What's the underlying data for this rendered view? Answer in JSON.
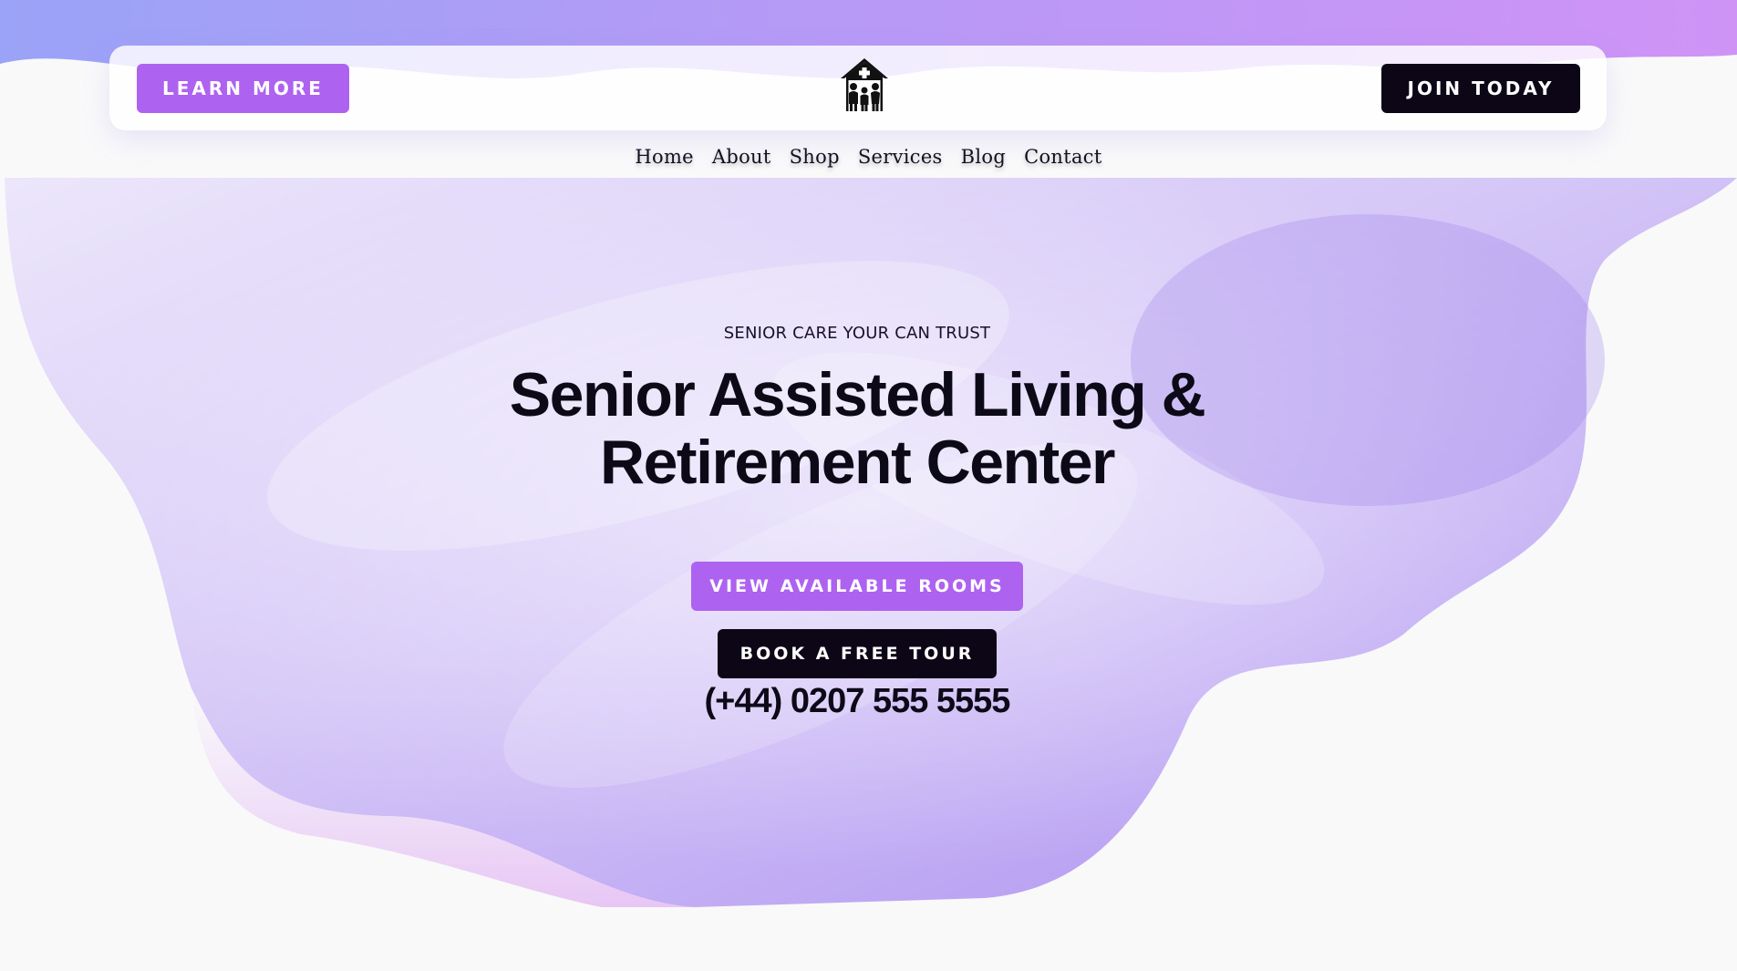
{
  "header": {
    "learn_more_label": "LEARN MORE",
    "join_today_label": "JOIN TODAY",
    "logo_icon": "senior-home-family-icon"
  },
  "nav": {
    "items": [
      {
        "label": "Home"
      },
      {
        "label": "About"
      },
      {
        "label": "Shop"
      },
      {
        "label": "Services"
      },
      {
        "label": "Blog"
      },
      {
        "label": "Contact"
      }
    ]
  },
  "hero": {
    "eyebrow": "SENIOR CARE YOUR CAN TRUST",
    "title_line1": "Senior Assisted Living &",
    "title_line2": "Retirement Center",
    "view_rooms_label": "VIEW AVAILABLE ROOMS",
    "book_tour_label": "BOOK A FREE TOUR",
    "phone": "(+44) 0207 555 5555"
  },
  "colors": {
    "accent_purple": "#ae62f0",
    "dark": "#0c0616",
    "gradient_start": "#9aa3f7",
    "gradient_end": "#cf93f6"
  }
}
